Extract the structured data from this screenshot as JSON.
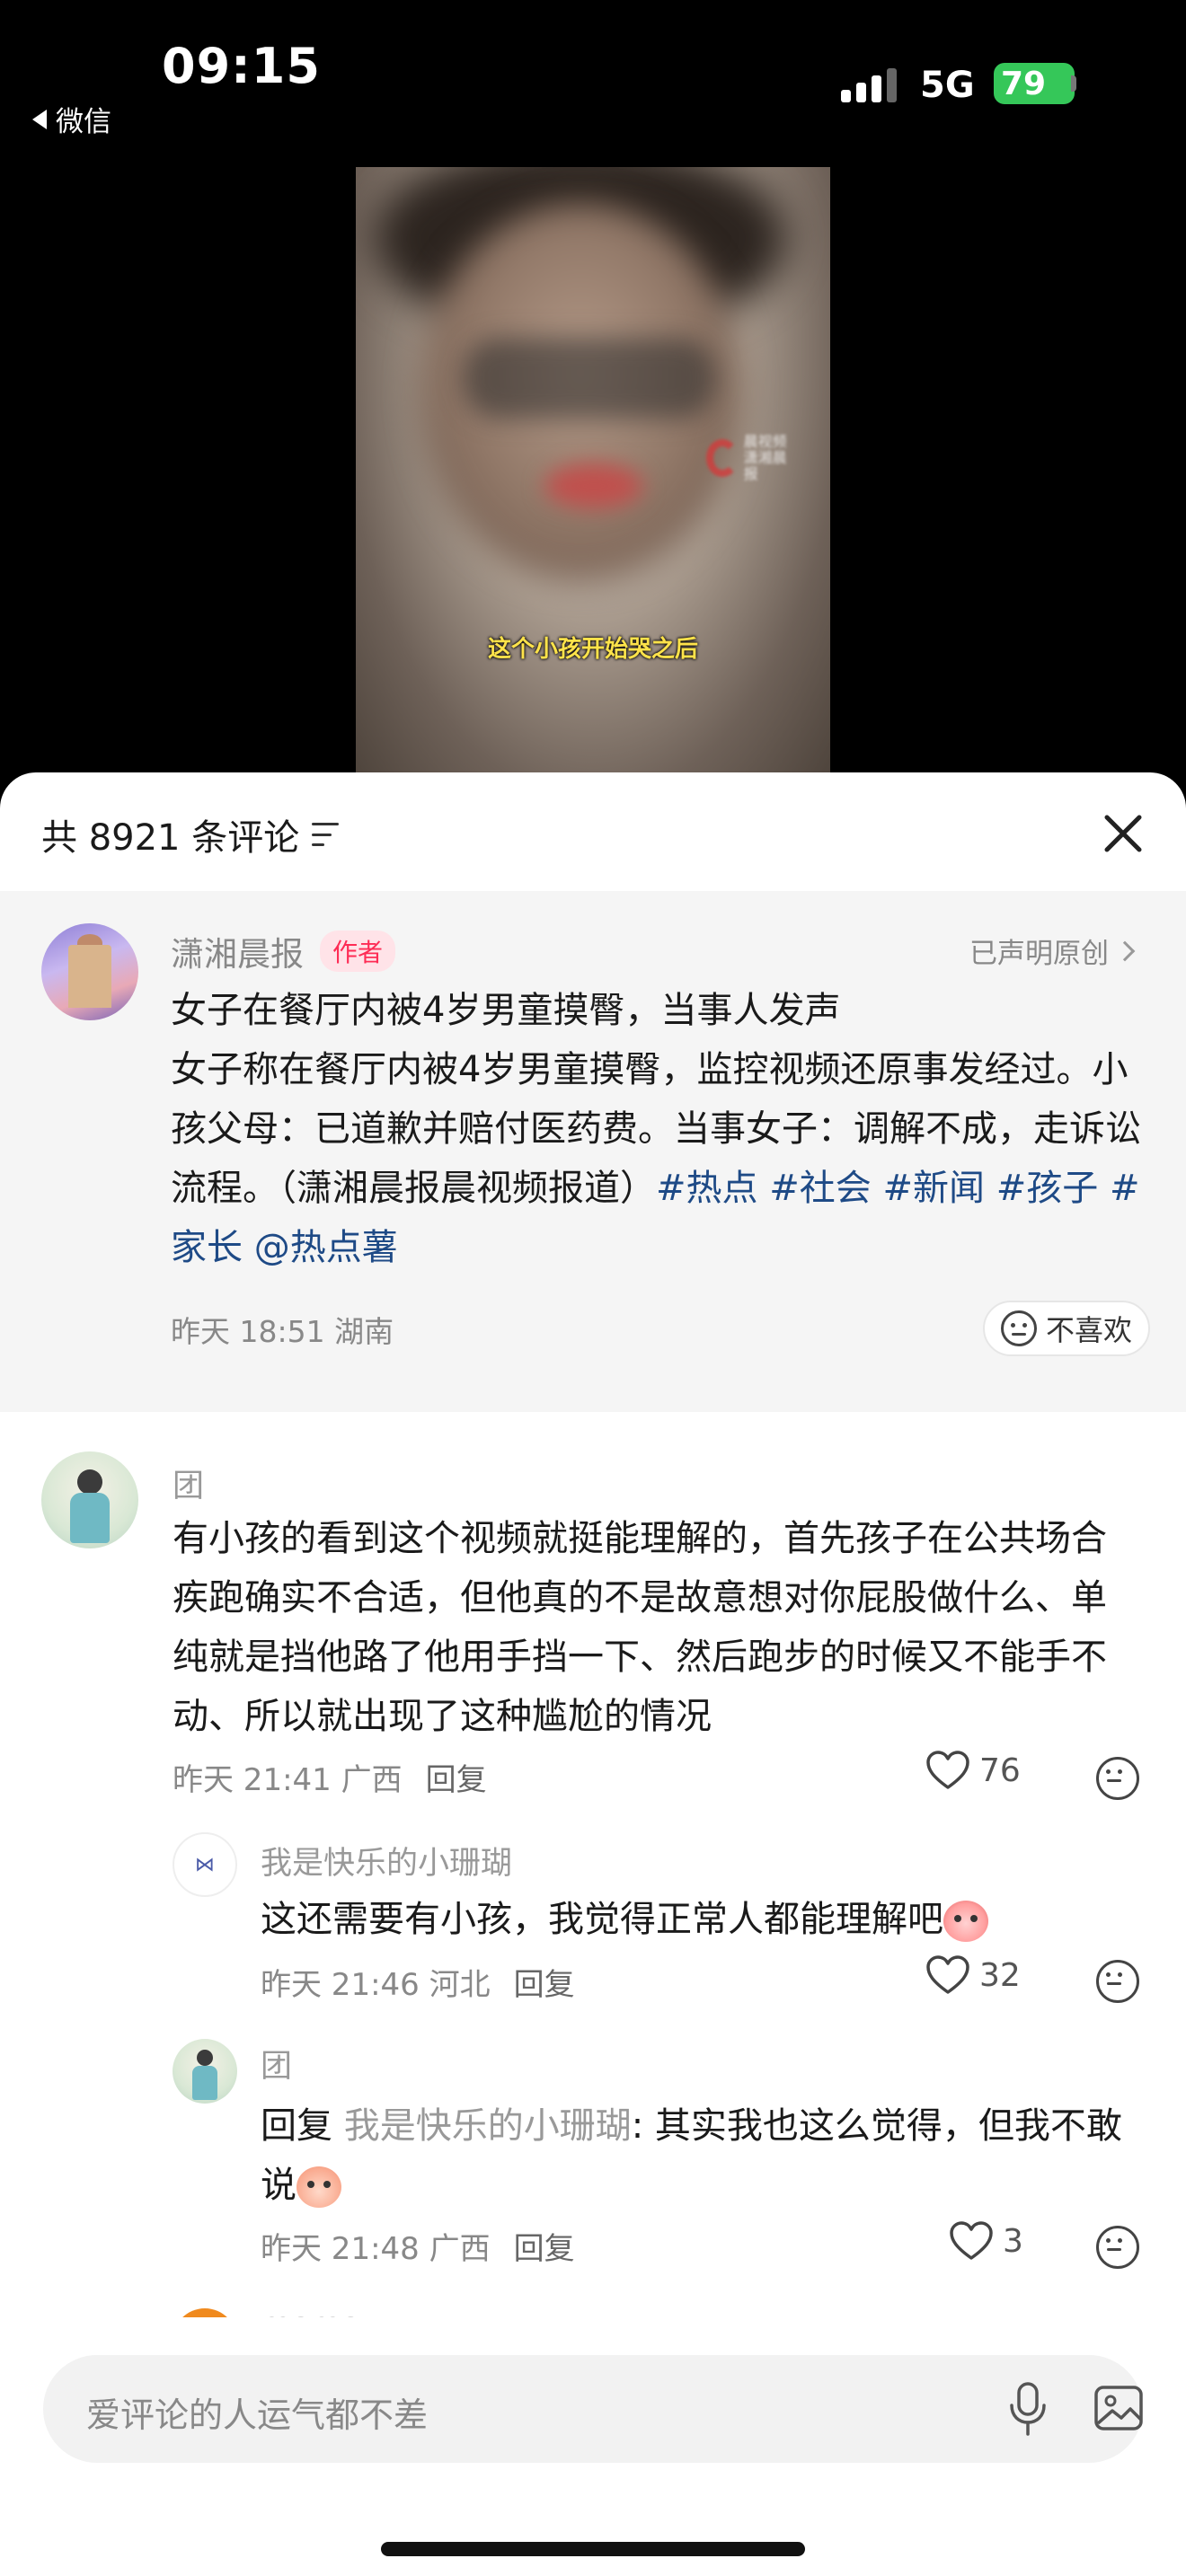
{
  "status_bar": {
    "time": "09:15",
    "back_label": "微信",
    "network": "5G",
    "battery": "79"
  },
  "video": {
    "subtitle": "这个小孩开始哭之后",
    "watermark_line1": "晨视频",
    "watermark_line2": "潇湘晨报"
  },
  "comments_header": {
    "title": "共 8921 条评论"
  },
  "pinned_post": {
    "author": "潇湘晨报",
    "author_badge": "作者",
    "original_label": "已声明原创",
    "title_line": "女子在餐厅内被4岁男童摸臀，当事人发声",
    "body": "女子称在餐厅内被4岁男童摸臀，监控视频还原事发经过。小孩父母：已道歉并赔付医药费。当事女子：调解不成，走诉讼流程。（潇湘晨报晨视频报道）",
    "tags": [
      "#热点",
      "#社会",
      "#新闻",
      "#孩子",
      "#家长",
      "@热点薯"
    ],
    "time_location": "昨天 18:51 湖南",
    "dislike_label": "不喜欢"
  },
  "comments": [
    {
      "name": "团",
      "text": "有小孩的看到这个视频就挺能理解的，首先孩子在公共场合疾跑确实不合适，但他真的不是故意想对你屁股做什么、单纯就是挡他路了他用手挡一下、然后跑步的时候又不能手不动、所以就出现了这种尴尬的情况",
      "time_location": "昨天 21:41 广西",
      "reply_label": "回复",
      "likes": "76"
    }
  ],
  "replies": [
    {
      "name": "我是快乐的小珊瑚",
      "text": "这还需要有小孩，我觉得正常人都能理解吧",
      "time_location": "昨天 21:46 河北",
      "reply_label": "回复",
      "likes": "32"
    },
    {
      "name": "团",
      "reply_prefix": "回复",
      "reply_to": "我是快乐的小珊瑚",
      "text": ": 其实我也这么觉得，但我不敢说",
      "time_location": "昨天 21:48 广西",
      "reply_label": "回复",
      "likes": "3"
    },
    {
      "name": "momo"
    }
  ],
  "input": {
    "placeholder": "爱评论的人运气都不差"
  },
  "icons": {
    "sort": "sort-icon",
    "close": "close-icon",
    "heart": "heart-icon",
    "dislike": "neutral-face-icon",
    "mic": "microphone-icon",
    "image": "image-icon"
  },
  "colors": {
    "accent_red": "#fe2c55",
    "tag_blue": "#1e4a86",
    "battery_green": "#35c759"
  }
}
